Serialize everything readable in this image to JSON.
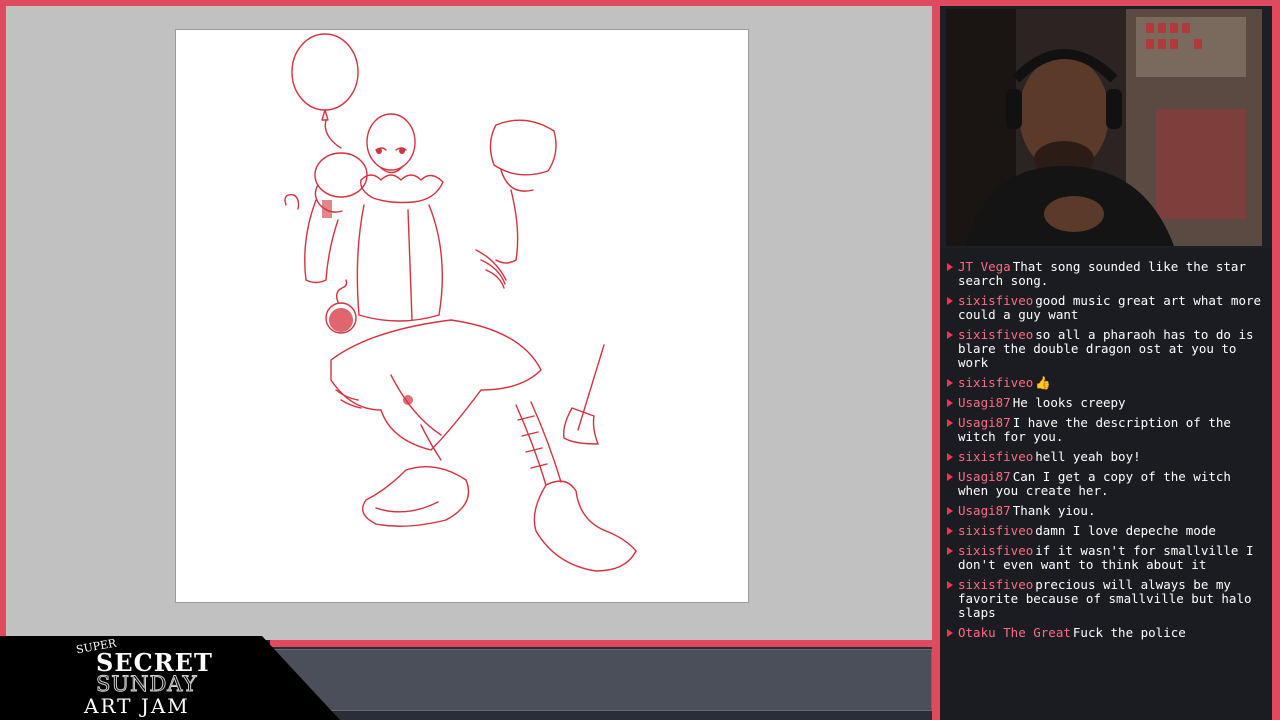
{
  "overlay": {
    "accent_color": "#e04a5e",
    "logo": {
      "line1": "SUPER",
      "line2": "SECRET",
      "line3": "SUNDAY",
      "line4": "ART JAM"
    }
  },
  "canvas": {
    "background": "#c1c1c1",
    "artboard_color": "#ffffff",
    "sketch_color": "#d4323e"
  },
  "chat": {
    "username_color": "#ff6b81",
    "messages": [
      {
        "user": "JT Vega",
        "text": "That song sounded like the star search song."
      },
      {
        "user": "sixisfiveo",
        "text": "good music great art what more could a guy want"
      },
      {
        "user": "sixisfiveo",
        "text": "so all a pharaoh has to do is blare the double dragon ost at you to work"
      },
      {
        "user": "sixisfiveo",
        "text": "👍"
      },
      {
        "user": "Usagi87",
        "text": "He looks creepy"
      },
      {
        "user": "Usagi87",
        "text": "I have the description of the witch for you."
      },
      {
        "user": "sixisfiveo",
        "text": "hell yeah boy!"
      },
      {
        "user": "Usagi87",
        "text": "Can I get a copy of the witch when you create her."
      },
      {
        "user": "Usagi87",
        "text": "Thank yiou."
      },
      {
        "user": "sixisfiveo",
        "text": "damn I love depeche mode"
      },
      {
        "user": "sixisfiveo",
        "text": "if it wasn't for smallville I don't even want to think about it"
      },
      {
        "user": "sixisfiveo",
        "text": "precious will always be my favorite because of smallville but halo slaps"
      },
      {
        "user": "Otaku The Great",
        "text": "Fuck the police"
      }
    ]
  }
}
